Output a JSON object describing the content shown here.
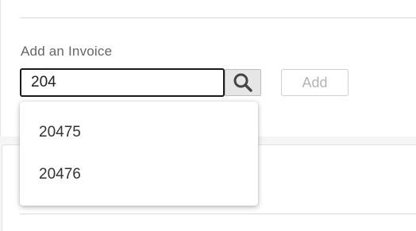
{
  "add_invoice": {
    "label": "Add an Invoice",
    "input_value": "204",
    "search_icon": "search-icon",
    "add_button_label": "Add",
    "add_button_enabled": false
  },
  "suggestions": [
    {
      "label": "20475"
    },
    {
      "label": "20476"
    }
  ],
  "colors": {
    "input_border": "#1a1a1a",
    "search_button_bg": "#e6e6e6",
    "disabled_text": "#b4b4b4",
    "page_bg": "#f5f5f5"
  }
}
